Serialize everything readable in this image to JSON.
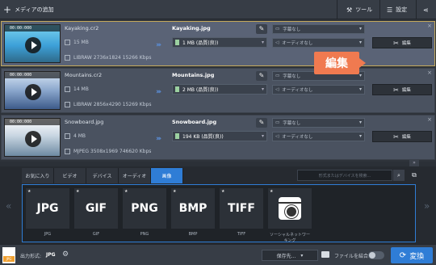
{
  "toolbar": {
    "add_media": "メディアの追加",
    "tools": "ツール",
    "settings": "設定"
  },
  "files": [
    {
      "time": "00:00:000",
      "source_name": "Kayaking.cr2",
      "source_size": "15 MB",
      "source_info": "LIBRAW 2736x1824 15266 Kbps",
      "output_name": "Kayaking.jpg",
      "output_format": "1 MB (品質(良))",
      "subtitles": "字幕なし",
      "audio": "オーディオなし",
      "edit_label": "編集",
      "thumb_colors": [
        "#3da0d8",
        "#7bd3f0"
      ]
    },
    {
      "time": "00:00:000",
      "source_name": "Mountains.cr2",
      "source_size": "14 MB",
      "source_info": "LIBRAW 2856x4290 15269 Kbps",
      "output_name": "Mountains.jpg",
      "output_format": "2 MB (品質(良))",
      "subtitles": "字幕なし",
      "audio": "オーディオなし",
      "edit_label": "編集",
      "thumb_colors": [
        "#5c7fb8",
        "#d8e6f5"
      ]
    },
    {
      "time": "00:00:000",
      "source_name": "Snowboard.jpg",
      "source_size": "4 MB",
      "source_info": "MJPEG 3508x1969 746620 Kbps",
      "output_name": "Snowboard.jpg",
      "output_format": "194 KB (品質(良))",
      "subtitles": "字幕なし",
      "audio": "オーディオなし",
      "edit_label": "編集",
      "thumb_colors": [
        "#b8c6d4",
        "#ffffff"
      ]
    }
  ],
  "callout": "編集",
  "tabs": [
    "お気に入り",
    "ビデオ",
    "デバイス",
    "オーディオ",
    "画像"
  ],
  "search_placeholder": "形式またはデバイスを検索...",
  "formats": [
    {
      "card": "JPG",
      "label": "JPG"
    },
    {
      "card": "GIF",
      "label": "GIF"
    },
    {
      "card": "PNG",
      "label": "PNG"
    },
    {
      "card": "BMP",
      "label": "BMP"
    },
    {
      "card": "TIFF",
      "label": "TIFF"
    },
    {
      "card": "",
      "label": "ソーシャルネットワーキング"
    }
  ],
  "bottom": {
    "output_label": "出力形式:",
    "output_value": "JPG",
    "save_to": "保存先...",
    "merge_label": "ファイルを結合:",
    "convert": "変換"
  },
  "colors": {
    "accent": "#2f7dd6",
    "callout": "#f07a50",
    "selected_border": "#c4a95c"
  }
}
